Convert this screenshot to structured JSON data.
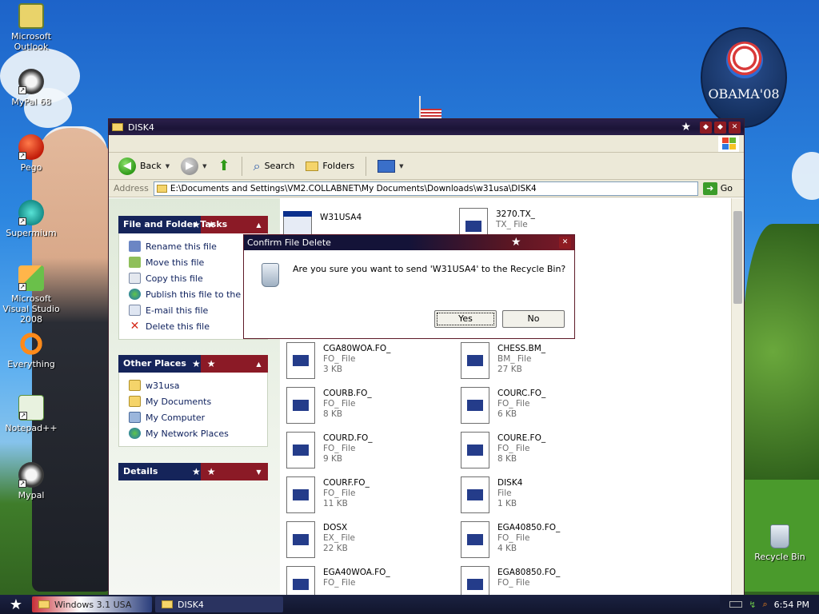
{
  "desktop": {
    "icons": [
      {
        "label": "Microsoft Outlook",
        "icon": "outlook-icon"
      },
      {
        "label": "MyPal 68",
        "icon": "mypal-icon"
      },
      {
        "label": "Pego",
        "icon": "pego-icon"
      },
      {
        "label": "Supermium",
        "icon": "supermium-icon"
      },
      {
        "label": "Microsoft Visual Studio 2008",
        "icon": "visual-studio-icon"
      },
      {
        "label": "Everything",
        "icon": "everything-icon"
      },
      {
        "label": "Notepad++",
        "icon": "notepadpp-icon"
      },
      {
        "label": "Mypal",
        "icon": "mypal-icon"
      }
    ],
    "recycle_bin": "Recycle Bin",
    "badge_text": "OBAMA'08"
  },
  "window": {
    "title": "DISK4",
    "toolbar": {
      "back": "Back",
      "search": "Search",
      "folders": "Folders"
    },
    "address": {
      "label": "Address",
      "path": "E:\\Documents and Settings\\VM2.COLLABNET\\My Documents\\Downloads\\w31usa\\DISK4",
      "go": "Go"
    },
    "panels": {
      "file_tasks": {
        "title": "File and Folder Tasks",
        "items": [
          "Rename this file",
          "Move this file",
          "Copy this file",
          "Publish this file to the Web",
          "E-mail this file",
          "Delete this file"
        ]
      },
      "other_places": {
        "title": "Other Places",
        "items": [
          "w31usa",
          "My Documents",
          "My Computer",
          "My Network Places"
        ]
      },
      "details": {
        "title": "Details"
      }
    },
    "files": [
      {
        "name": "W31USA4",
        "type": "",
        "size": ""
      },
      {
        "name": "3270.TX_",
        "type": "TX_ File",
        "size": ""
      },
      {
        "name": "CGA80WOA.FO_",
        "type": "FO_ File",
        "size": "3 KB"
      },
      {
        "name": "CHESS.BM_",
        "type": "BM_ File",
        "size": "27 KB"
      },
      {
        "name": "COURB.FO_",
        "type": "FO_ File",
        "size": "8 KB"
      },
      {
        "name": "COURC.FO_",
        "type": "FO_ File",
        "size": "6 KB"
      },
      {
        "name": "COURD.FO_",
        "type": "FO_ File",
        "size": "9 KB"
      },
      {
        "name": "COURE.FO_",
        "type": "FO_ File",
        "size": "8 KB"
      },
      {
        "name": "COURF.FO_",
        "type": "FO_ File",
        "size": "11 KB"
      },
      {
        "name": "DISK4",
        "type": "File",
        "size": "1 KB"
      },
      {
        "name": "DOSX",
        "type": "EX_ File",
        "size": "22 KB"
      },
      {
        "name": "EGA40850.FO_",
        "type": "FO_ File",
        "size": "4 KB"
      },
      {
        "name": "EGA40WOA.FO_",
        "type": "FO_ File",
        "size": ""
      },
      {
        "name": "EGA80850.FO_",
        "type": "FO_ File",
        "size": ""
      }
    ]
  },
  "dialog": {
    "title": "Confirm File Delete",
    "message": "Are you sure you want to send 'W31USA4' to the Recycle Bin?",
    "yes": "Yes",
    "no": "No"
  },
  "taskbar": {
    "tasks": [
      "Windows 3.1 USA",
      "DISK4"
    ],
    "clock": "6:54 PM"
  }
}
